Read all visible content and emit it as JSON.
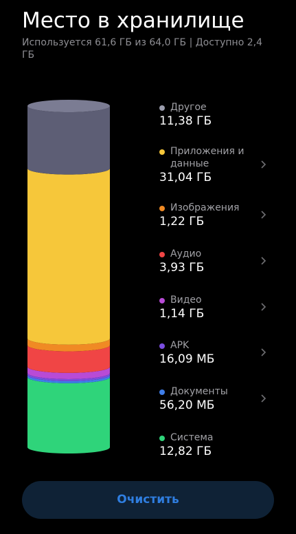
{
  "header": {
    "title": "Место в хранилище",
    "subtitle": "Используется 61,6 ГБ из 64,0 ГБ | Доступно 2,4 ГБ"
  },
  "legend": [
    {
      "label": "Другое",
      "value": "11,38 ГБ",
      "color": "#9b9dad",
      "has_chevron": false
    },
    {
      "label": "Приложения и данные",
      "value": "31,04 ГБ",
      "color": "#f6c73a",
      "has_chevron": true
    },
    {
      "label": "Изображения",
      "value": "1,22 ГБ",
      "color": "#f08a24",
      "has_chevron": true
    },
    {
      "label": "Аудио",
      "value": "3,93 ГБ",
      "color": "#f04545",
      "has_chevron": true
    },
    {
      "label": "Видео",
      "value": "1,14 ГБ",
      "color": "#b84bd6",
      "has_chevron": true
    },
    {
      "label": "APK",
      "value": "16,09 МБ",
      "color": "#7a4de0",
      "has_chevron": true
    },
    {
      "label": "Документы",
      "value": "56,20 МБ",
      "color": "#3f7ee9",
      "has_chevron": true
    },
    {
      "label": "Система",
      "value": "12,82 ГБ",
      "color": "#2fd47a",
      "has_chevron": false
    }
  ],
  "cylinder_segments": [
    {
      "name": "other",
      "color": "#5d5e75",
      "top_color": "#7b7c93",
      "gb": 11.38
    },
    {
      "name": "apps",
      "color": "#f6c73a",
      "gb": 31.04
    },
    {
      "name": "images",
      "color": "#f08a24",
      "gb": 1.22
    },
    {
      "name": "audio",
      "color": "#f04545",
      "gb": 3.93
    },
    {
      "name": "video",
      "color": "#b84bd6",
      "gb": 1.14
    },
    {
      "name": "apk",
      "color": "#7a4de0",
      "gb": 0.016
    },
    {
      "name": "documents",
      "color": "#3f7ee9",
      "gb": 0.056
    },
    {
      "name": "system",
      "color": "#2fd47a",
      "gb": 12.82
    }
  ],
  "footer": {
    "button_label": "Очистить"
  }
}
